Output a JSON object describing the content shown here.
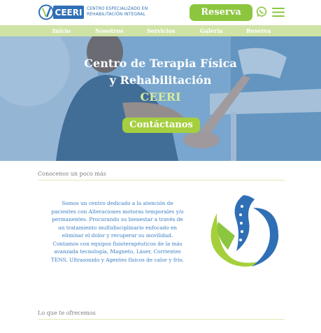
{
  "header": {
    "logo_word": "CEERI",
    "logo_line1": "CENTRO ESPECIALIZADO EN",
    "logo_line2": "REHABILITACIÓN INTEGRAL",
    "reserva_label": "Reserva"
  },
  "nav": {
    "items": [
      {
        "label": "Inicio"
      },
      {
        "label": "Nosotros"
      },
      {
        "label": "Servicios"
      },
      {
        "label": "Galeria"
      },
      {
        "label": "Reserva"
      }
    ]
  },
  "hero": {
    "title_line1": "Centro de Terapia Física",
    "title_line2": "y Rehabilitación",
    "brand": "CEERI",
    "cta_label": "Contáctanos"
  },
  "about": {
    "heading": "Conocenos un poco más",
    "lines": [
      "Somos un centro dedicado a la atención de",
      "pacientes con Alteraciones motoras temporales y/o",
      "permanentes. Procurando su bienestar a través de",
      "un tratamiento multidisciplinario enfocado en",
      "eliminar el dolor y recuperar su movilidad.",
      "Contamos con equipos fisioterapéuticos de la más",
      "avanzada tecnología, Magneto, Láser, Corrientes",
      "TENS, Ultrasonido y Agentes físicos de calor y frío."
    ]
  },
  "offer": {
    "heading": "Lo que te ofrecemos"
  },
  "colors": {
    "brand_green": "#8cc63f",
    "brand_blue": "#2f6fb6",
    "nav_bg": "#cfe3a6"
  }
}
